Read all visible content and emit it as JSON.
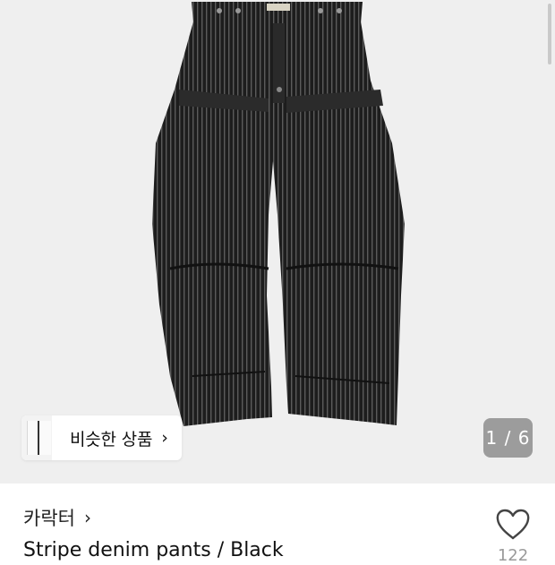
{
  "product_image": {
    "alt": "Stripe denim pants / Black",
    "icon": "black-striped-denim-pants"
  },
  "similar_products": {
    "label": "비슷한 상품",
    "chevron": "›"
  },
  "gallery": {
    "counter": "1 / 6"
  },
  "brand": {
    "name": "카락터",
    "chevron": "›"
  },
  "product": {
    "title": "Stripe denim pants / Black"
  },
  "like": {
    "icon": "heart-outline-icon",
    "count": "122"
  },
  "colors": {
    "hero_background": "#efefef",
    "counter_background": "#9c9c9c",
    "text": "#111111",
    "muted": "#9a9a9a"
  }
}
